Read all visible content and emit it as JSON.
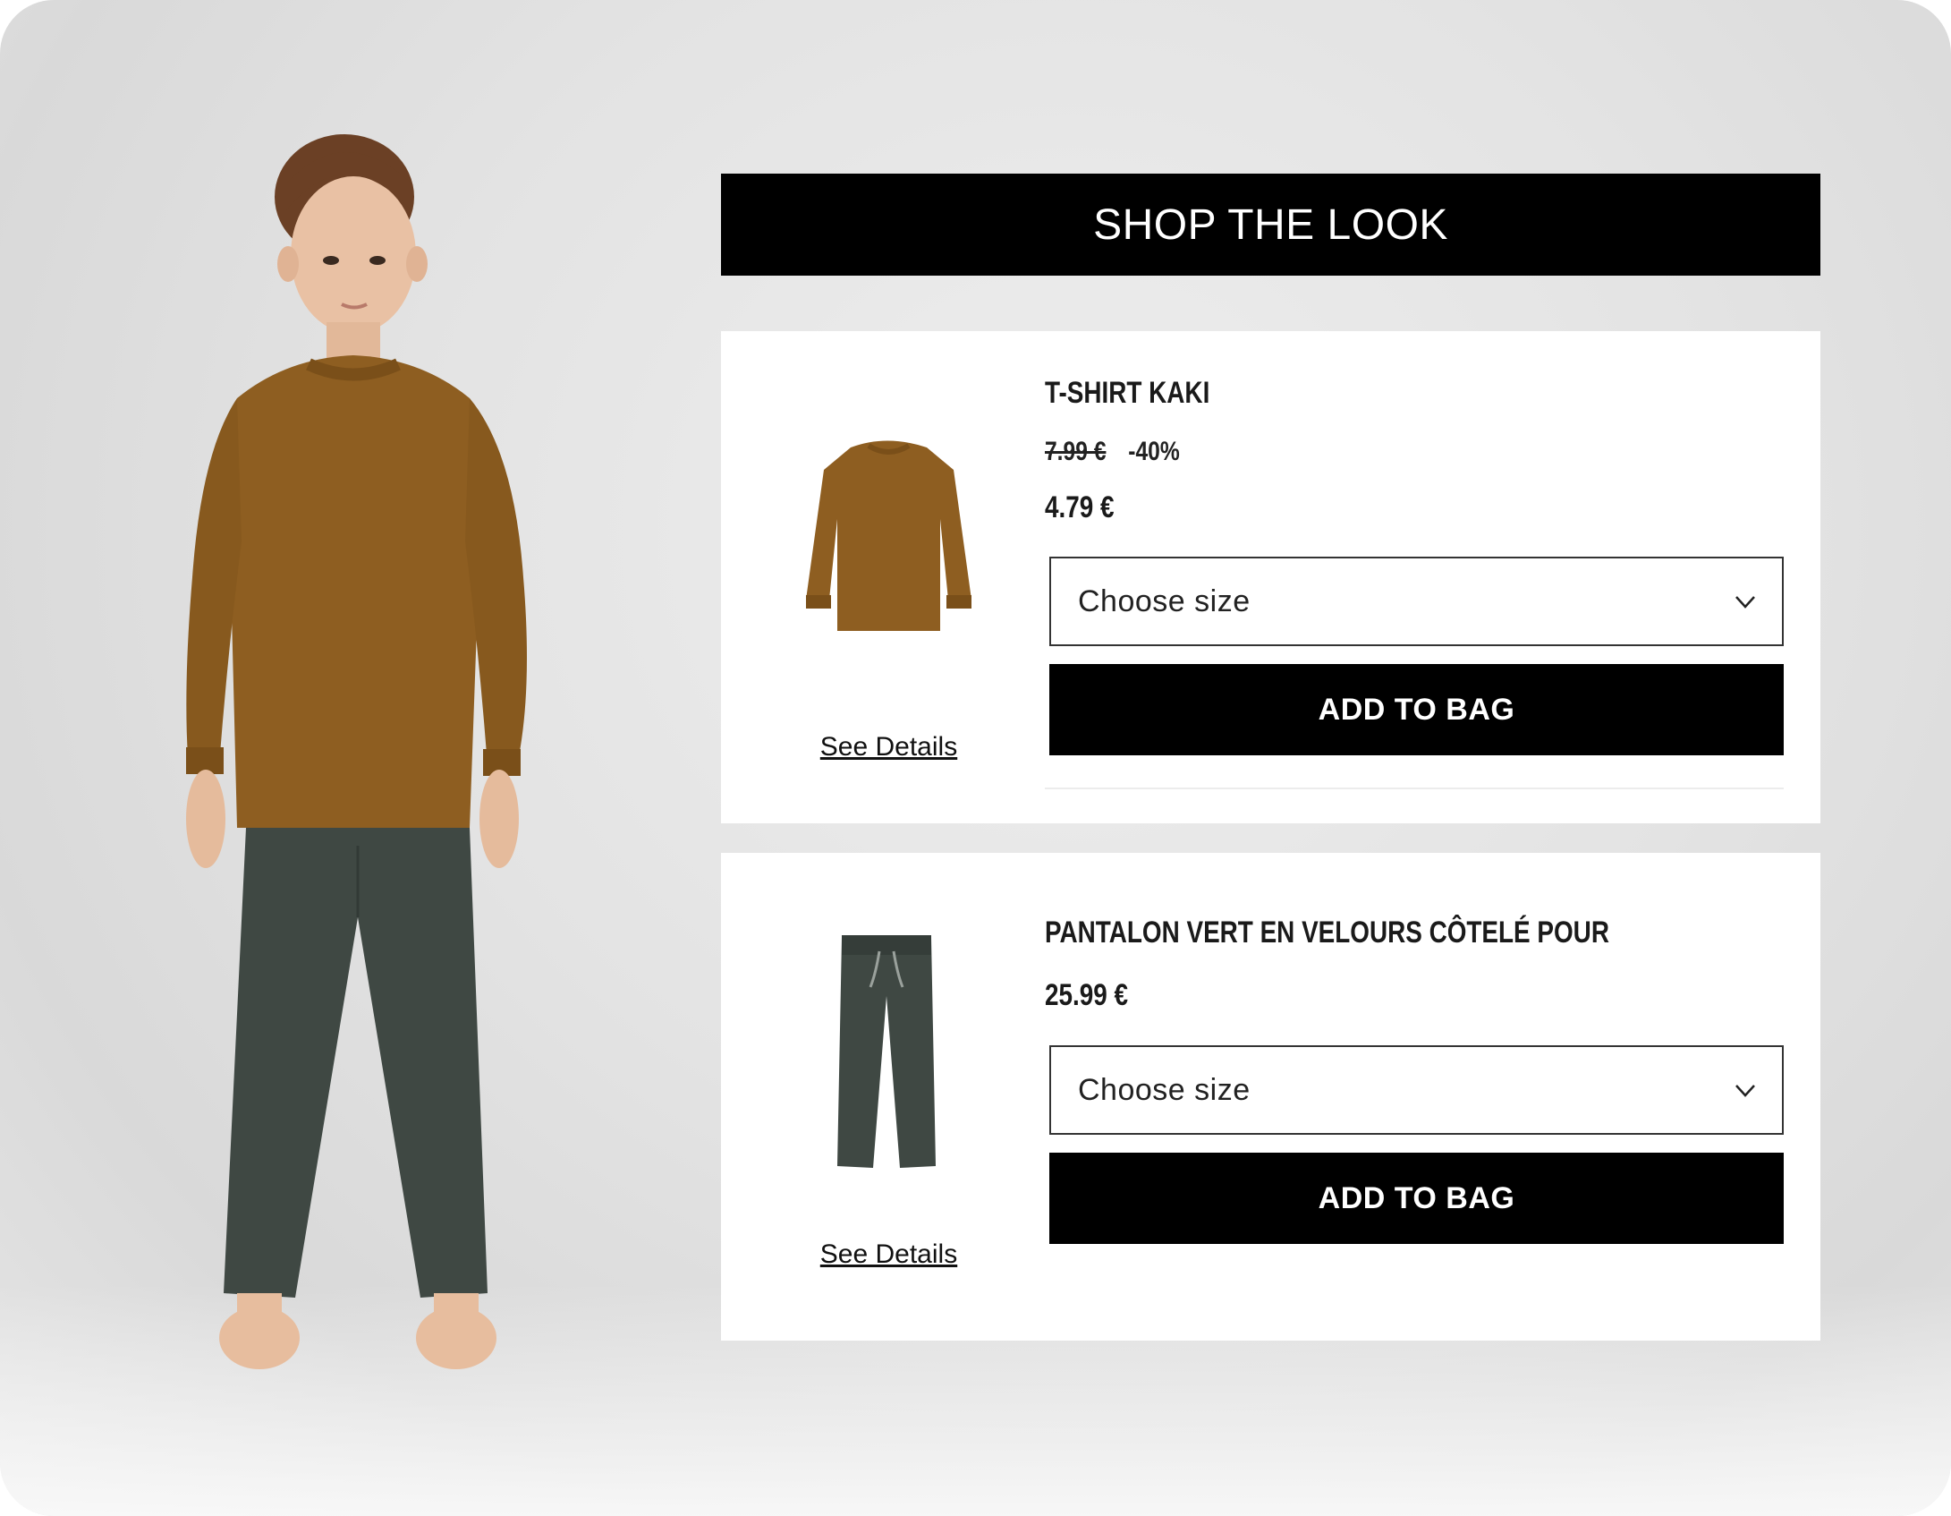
{
  "header": {
    "title": "SHOP THE LOOK"
  },
  "products": [
    {
      "title": "T-SHIRT KAKI",
      "old_price": "7.99 €",
      "discount": "-40%",
      "price": "4.79 €",
      "size_placeholder": "Choose size",
      "add_label": "ADD TO BAG",
      "details_label": "See Details",
      "color": "#8a5a1e"
    },
    {
      "title": "PANTALON VERT EN VELOURS CÔTELÉ POUR",
      "price": "25.99 €",
      "size_placeholder": "Choose size",
      "add_label": "ADD TO BAG",
      "details_label": "See Details",
      "color": "#3b443e"
    }
  ],
  "icons": {
    "dropdown": "chevron-down-icon"
  }
}
